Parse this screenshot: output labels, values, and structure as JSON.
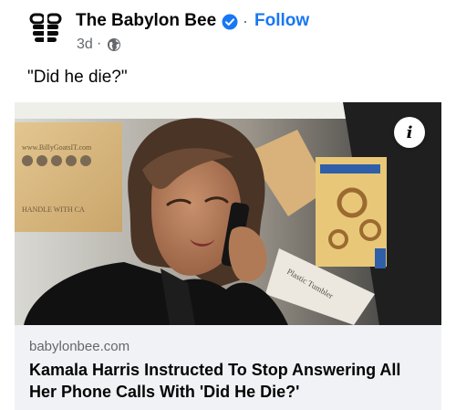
{
  "post": {
    "page_name": "The Babylon Bee",
    "follow_label": "Follow",
    "separator": "·",
    "time": "3d",
    "time_separator": "·",
    "caption": "\"Did he die?\"",
    "logo_icon": "babylon-bee-logo",
    "verified_icon": "verified-badge-icon",
    "audience_icon": "globe-icon"
  },
  "media": {
    "box_text_1": "www.BillyGoatsIT.com",
    "box_text_2": "HANDLE WITH CA",
    "box_text_3": "Plastic Tumbler",
    "info_icon": "info-icon"
  },
  "link": {
    "domain": "babylonbee.com",
    "headline": "Kamala Harris Instructed To Stop Answering All Her Phone Calls With 'Did He Die?'"
  },
  "colors": {
    "accent": "#1877f2",
    "secondary_text": "#65676b",
    "card_bg": "#f0f2f5",
    "logo": "#0a0a0a"
  }
}
